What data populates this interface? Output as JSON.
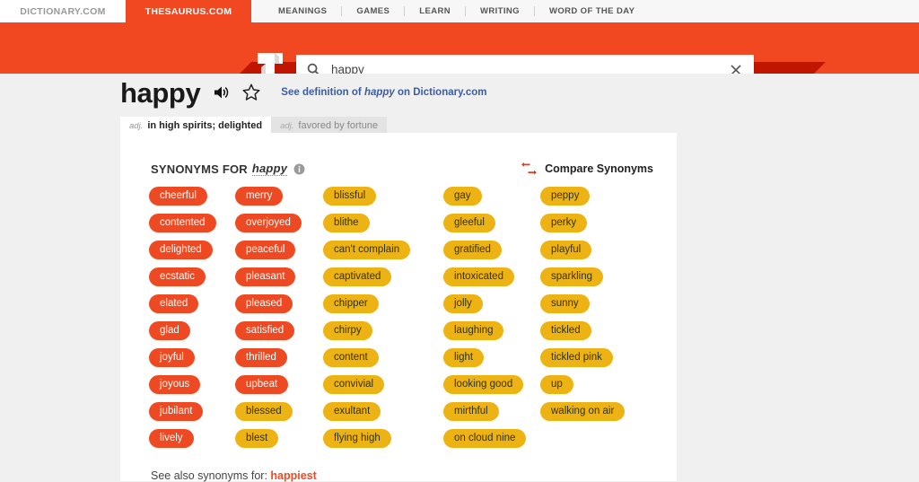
{
  "nav": {
    "tabs": [
      {
        "label": "DICTIONARY.COM",
        "active": false
      },
      {
        "label": "THESAURUS.COM",
        "active": true
      }
    ],
    "links": [
      "MEANINGS",
      "GAMES",
      "LEARN",
      "WRITING",
      "WORD OF THE DAY"
    ]
  },
  "search": {
    "value": "happy",
    "placeholder": "",
    "search_icon": "search-icon",
    "clear_icon": "close-icon",
    "logo": "thesaurus-t-logo"
  },
  "entry": {
    "word": "happy",
    "speaker_icon": "speaker-icon",
    "star_icon": "star-outline-icon",
    "see_definition": {
      "prefix": "See definition of ",
      "word": "happy",
      "suffix": " on Dictionary.com"
    }
  },
  "definition_tabs": [
    {
      "pos": "adj.",
      "sense": "in high spirits; delighted",
      "active": true
    },
    {
      "pos": "adj.",
      "sense": "favored by fortune",
      "active": false
    }
  ],
  "synonyms_section": {
    "title_prefix": "SYNONYMS FOR",
    "title_word": "happy",
    "info_icon": "info-icon",
    "compare_label": "Compare Synonyms",
    "compare_icon": "compare-arrows-icon",
    "see_also_prefix": "See also synonyms for: ",
    "see_also_link": "happiest"
  },
  "colors": {
    "brand_red": "#f24822",
    "chip_red": "#ed4a24",
    "chip_gold": "#edb213",
    "link_blue": "#3b5ca8",
    "page_bg": "#f0f0f0",
    "header_shadow": "#c01500"
  },
  "synonym_columns": [
    {
      "relevance": "strong",
      "chips": [
        {
          "label": "cheerful",
          "tone": "red"
        },
        {
          "label": "contented",
          "tone": "red"
        },
        {
          "label": "delighted",
          "tone": "red"
        },
        {
          "label": "ecstatic",
          "tone": "red"
        },
        {
          "label": "elated",
          "tone": "red"
        },
        {
          "label": "glad",
          "tone": "red"
        },
        {
          "label": "joyful",
          "tone": "red"
        },
        {
          "label": "joyous",
          "tone": "red"
        },
        {
          "label": "jubilant",
          "tone": "red"
        },
        {
          "label": "lively",
          "tone": "red"
        }
      ]
    },
    {
      "relevance": "strong",
      "chips": [
        {
          "label": "merry",
          "tone": "red"
        },
        {
          "label": "overjoyed",
          "tone": "red"
        },
        {
          "label": "peaceful",
          "tone": "red"
        },
        {
          "label": "pleasant",
          "tone": "red"
        },
        {
          "label": "pleased",
          "tone": "red"
        },
        {
          "label": "satisfied",
          "tone": "red"
        },
        {
          "label": "thrilled",
          "tone": "red"
        },
        {
          "label": "upbeat",
          "tone": "red"
        },
        {
          "label": "blessed",
          "tone": "gold"
        },
        {
          "label": "blest",
          "tone": "gold"
        }
      ]
    },
    {
      "relevance": "medium",
      "chips": [
        {
          "label": "blissful",
          "tone": "gold"
        },
        {
          "label": "blithe",
          "tone": "gold"
        },
        {
          "label": "can't complain",
          "tone": "gold"
        },
        {
          "label": "captivated",
          "tone": "gold"
        },
        {
          "label": "chipper",
          "tone": "gold"
        },
        {
          "label": "chirpy",
          "tone": "gold"
        },
        {
          "label": "content",
          "tone": "gold"
        },
        {
          "label": "convivial",
          "tone": "gold"
        },
        {
          "label": "exultant",
          "tone": "gold"
        },
        {
          "label": "flying high",
          "tone": "gold"
        }
      ]
    },
    {
      "relevance": "medium",
      "chips": [
        {
          "label": "gay",
          "tone": "gold"
        },
        {
          "label": "gleeful",
          "tone": "gold"
        },
        {
          "label": "gratified",
          "tone": "gold"
        },
        {
          "label": "intoxicated",
          "tone": "gold"
        },
        {
          "label": "jolly",
          "tone": "gold"
        },
        {
          "label": "laughing",
          "tone": "gold"
        },
        {
          "label": "light",
          "tone": "gold"
        },
        {
          "label": "looking good",
          "tone": "gold"
        },
        {
          "label": "mirthful",
          "tone": "gold"
        },
        {
          "label": "on cloud nine",
          "tone": "gold"
        }
      ]
    },
    {
      "relevance": "medium",
      "chips": [
        {
          "label": "peppy",
          "tone": "gold"
        },
        {
          "label": "perky",
          "tone": "gold"
        },
        {
          "label": "playful",
          "tone": "gold"
        },
        {
          "label": "sparkling",
          "tone": "gold"
        },
        {
          "label": "sunny",
          "tone": "gold"
        },
        {
          "label": "tickled",
          "tone": "gold"
        },
        {
          "label": "tickled pink",
          "tone": "gold"
        },
        {
          "label": "up",
          "tone": "gold"
        },
        {
          "label": "walking on air",
          "tone": "gold"
        }
      ]
    }
  ]
}
